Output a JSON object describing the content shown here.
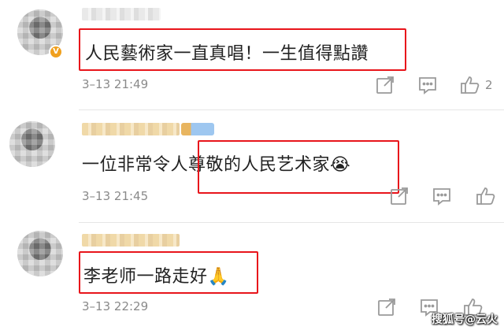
{
  "comments": [
    {
      "text": "人民藝術家一直真唱！一生值得點讚",
      "time": "3–13 21:49",
      "likes": "2",
      "verified_badge": "V"
    },
    {
      "text": "一位非常令人尊敬的人民艺术家😭",
      "time": "3–13 21:45",
      "likes": ""
    },
    {
      "text": "李老师一路走好🙏",
      "time": "3–13 22:29",
      "likes": ""
    }
  ],
  "watermark": "搜狐号@云火",
  "icons": {
    "share": "share-icon",
    "comment": "comment-icon",
    "like": "thumbs-up-icon"
  },
  "colors": {
    "highlight": "#e8151b",
    "verified": "#f0a01e"
  }
}
